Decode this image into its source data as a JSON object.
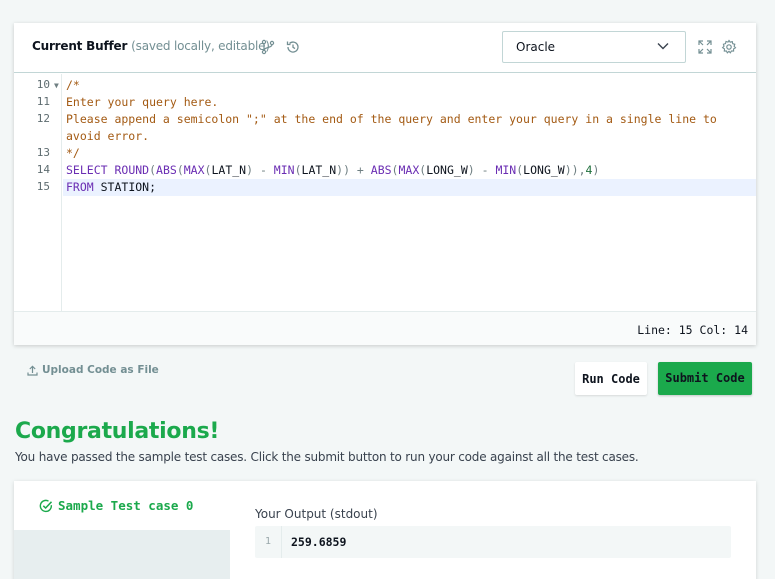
{
  "editor": {
    "title": "Current Buffer",
    "subtitle": "(saved locally, editable)",
    "language": "Oracle",
    "icons": {
      "branch": "git-branch-icon",
      "history": "history-icon",
      "fullscreen": "fullscreen-icon",
      "settings": "gear-icon",
      "dropdown": "chevron-down-icon"
    },
    "lines": [
      {
        "num": "10",
        "fold": true
      },
      {
        "num": "11"
      },
      {
        "num": "12"
      },
      {
        "num": "13"
      },
      {
        "num": "14"
      },
      {
        "num": "15"
      }
    ],
    "code": {
      "l10": "/*",
      "l11": "Enter your query here.",
      "l12a": "Please append a semicolon \";\" at the end of the query and enter your query in a single line to",
      "l12b": "avoid error.",
      "l13": "*/",
      "l14": {
        "t1": "SELECT",
        "t2": " ROUND",
        "t3": "(",
        "t4": "ABS",
        "t5": "(",
        "t6": "MAX",
        "t7": "(",
        "t8": "LAT_N",
        "t9": ") - ",
        "t10": "MIN",
        "t11": "(",
        "t12": "LAT_N",
        "t13": ")) + ",
        "t14": "ABS",
        "t15": "(",
        "t16": "MAX",
        "t17": "(",
        "t18": "LONG_W",
        "t19": ") - ",
        "t20": "MIN",
        "t21": "(",
        "t22": "LONG_W",
        "t23": ")),",
        "t24": "4",
        "t25": ")"
      },
      "l15": {
        "kw": "FROM",
        "rest": " STATION;"
      }
    },
    "status": "Line: 15 Col: 14"
  },
  "actions": {
    "upload": "Upload Code as File",
    "run": "Run Code",
    "submit": "Submit Code"
  },
  "result": {
    "heading": "Congratulations!",
    "message": "You have passed the sample test cases. Click the submit button to run your code against all the test cases.",
    "testcase": "Sample Test case 0",
    "output_label": "Your Output (stdout)",
    "output_line": "1",
    "output_value": "259.6859"
  },
  "colors": {
    "accent_green": "#1ba94c",
    "comment": "#a35a13",
    "keyword": "#6a2db3"
  }
}
